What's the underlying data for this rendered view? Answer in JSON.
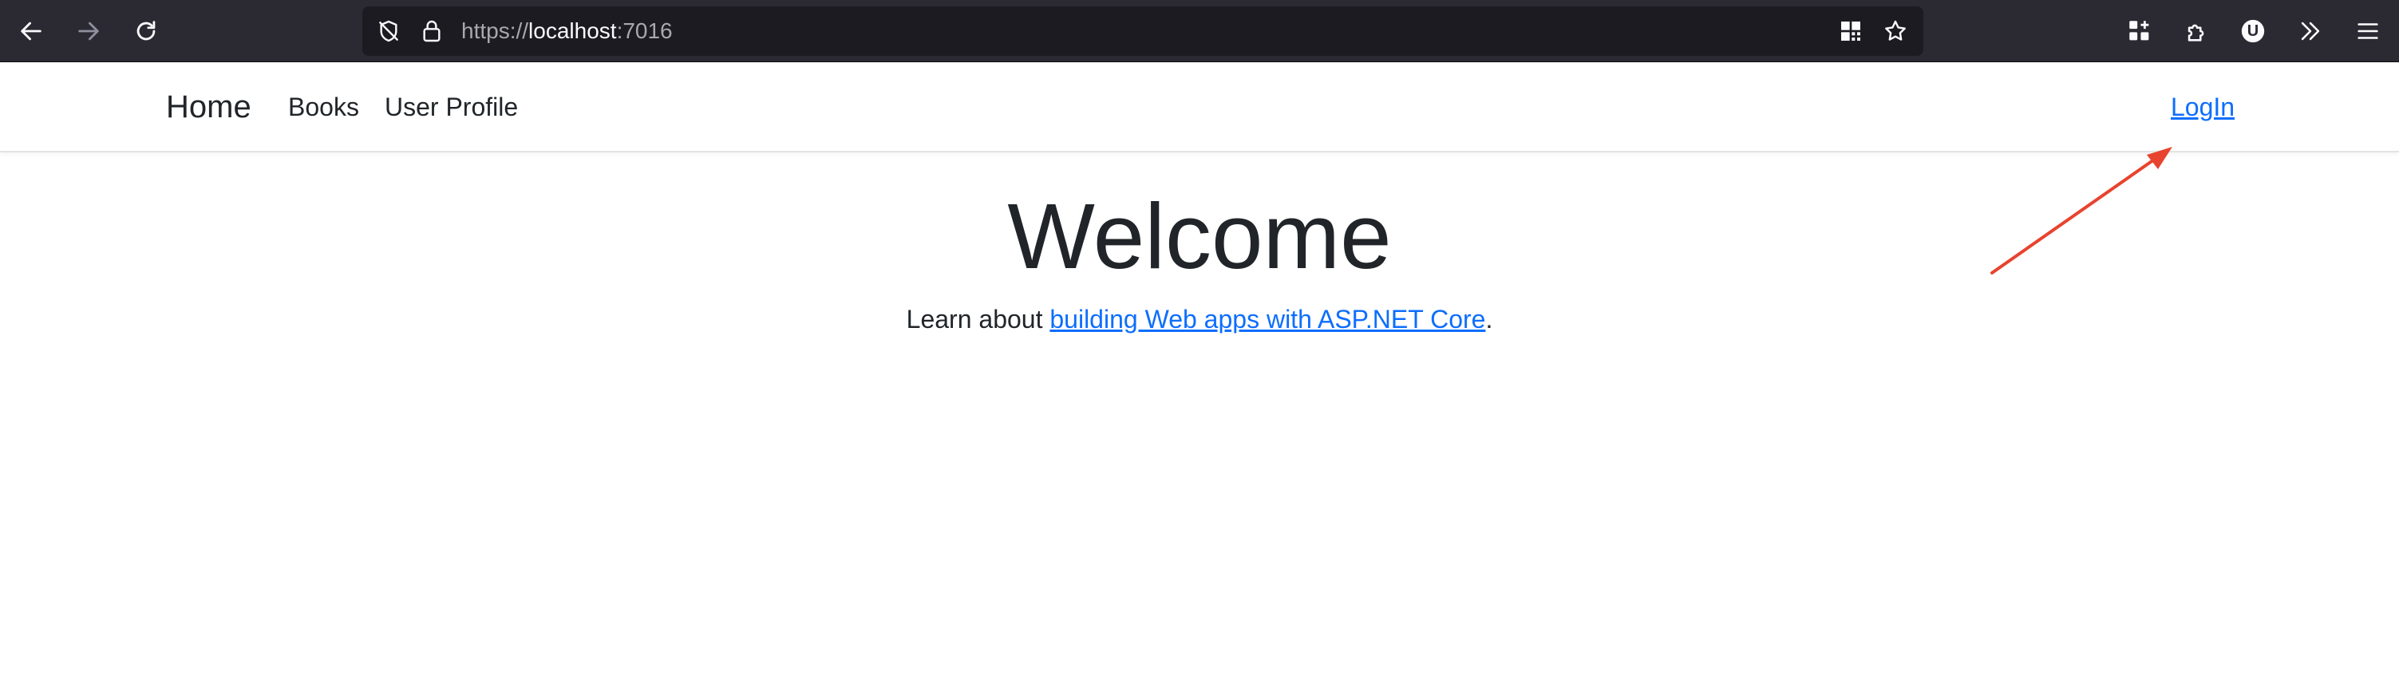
{
  "browser": {
    "url_scheme": "https://",
    "url_host": "localhost",
    "url_port": ":7016",
    "icons": {
      "back": "arrow-left-icon",
      "forward": "arrow-right-icon",
      "reload": "reload-icon",
      "tracking": "shield-slash-icon",
      "lock": "lock-icon",
      "qr": "qr-code-icon",
      "bookmark": "star-icon",
      "extensions_grid": "apps-icon",
      "extension_puzzle": "puzzle-icon",
      "account": "account-icon",
      "overflow": "double-chevron-icon",
      "menu": "hamburger-icon"
    },
    "account_initial": "U",
    "colors": {
      "toolbar": "#2b2a33",
      "urlbar": "#1c1b22"
    }
  },
  "site": {
    "brand": "Home",
    "nav": [
      {
        "label": "Books"
      },
      {
        "label": "User Profile"
      }
    ],
    "login_label": "LogIn",
    "colors": {
      "link": "#0d6efd",
      "text": "#212529"
    }
  },
  "main": {
    "heading": "Welcome",
    "learn_prefix": "Learn about ",
    "learn_link": "building Web apps with ASP.NET Core",
    "learn_suffix": "."
  },
  "annotation": {
    "arrow_color": "#e8432e",
    "points_to": "LogIn"
  }
}
